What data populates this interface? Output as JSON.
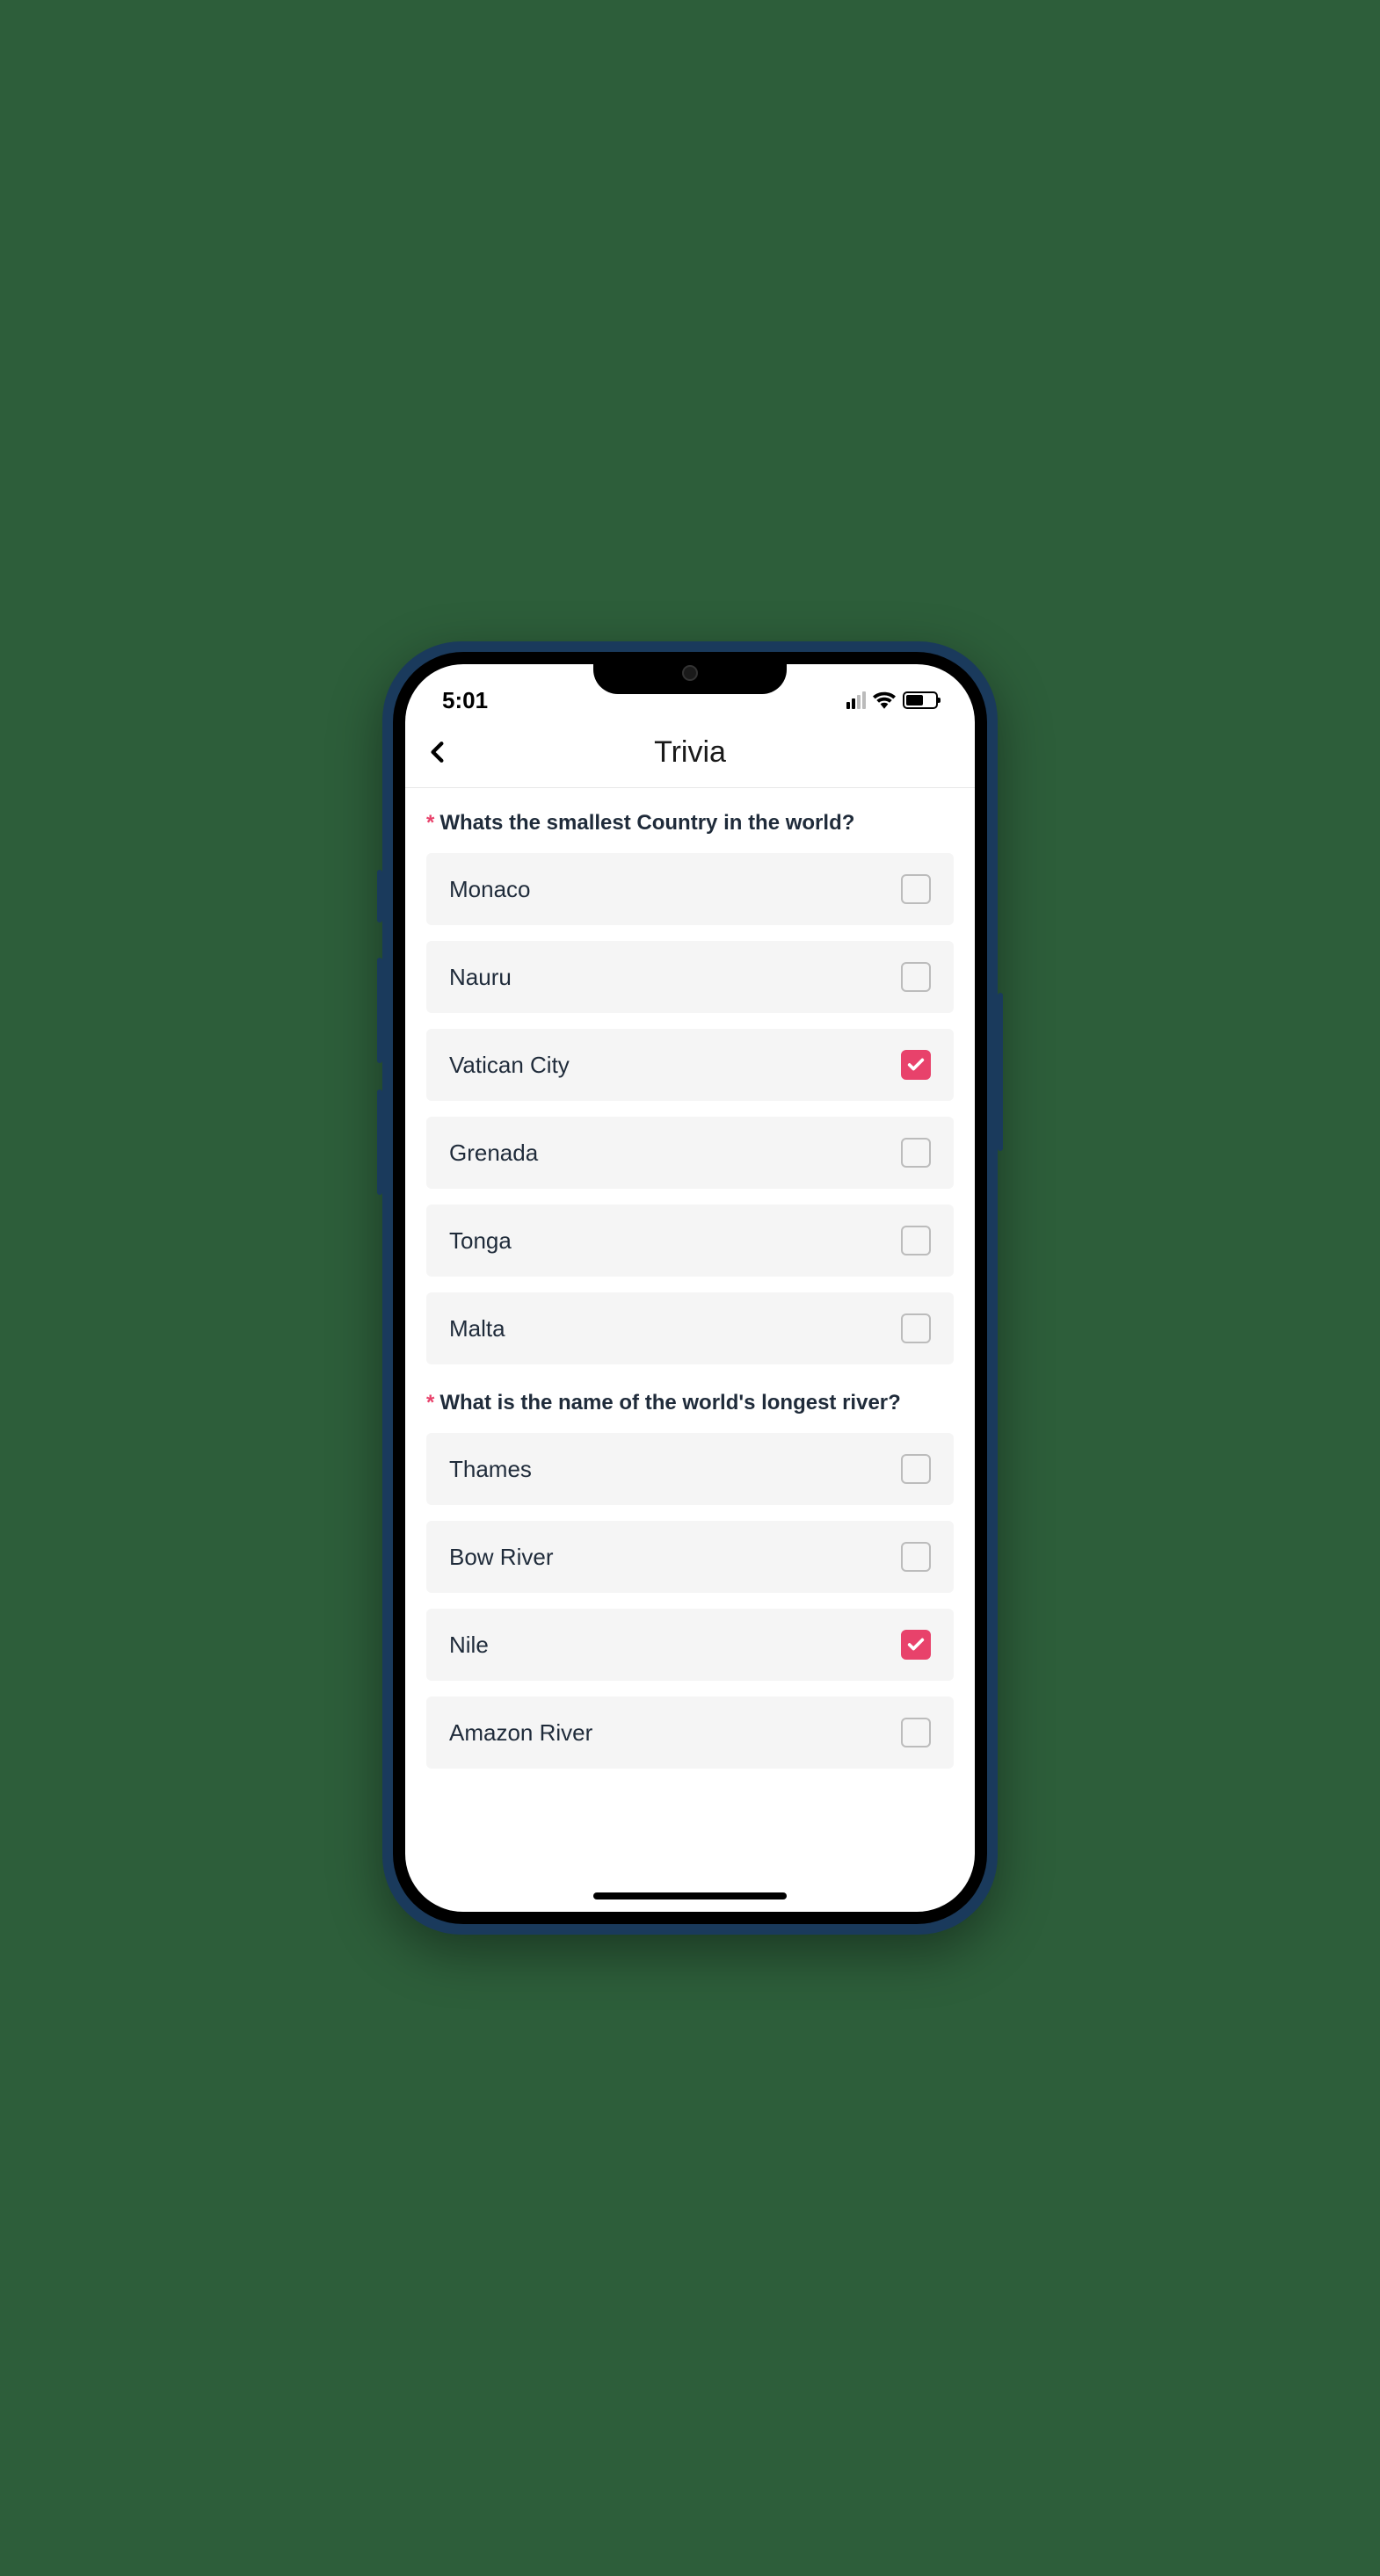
{
  "statusBar": {
    "time": "5:01"
  },
  "header": {
    "title": "Trivia"
  },
  "questions": [
    {
      "required": true,
      "text": "Whats the smallest Country in the world?",
      "options": [
        {
          "label": "Monaco",
          "checked": false
        },
        {
          "label": "Nauru",
          "checked": false
        },
        {
          "label": "Vatican City",
          "checked": true
        },
        {
          "label": "Grenada",
          "checked": false
        },
        {
          "label": "Tonga",
          "checked": false
        },
        {
          "label": "Malta",
          "checked": false
        }
      ]
    },
    {
      "required": true,
      "text": "What is the name of the world's longest river?",
      "options": [
        {
          "label": "Thames",
          "checked": false
        },
        {
          "label": "Bow River",
          "checked": false
        },
        {
          "label": "Nile",
          "checked": true
        },
        {
          "label": "Amazon River",
          "checked": false
        }
      ]
    }
  ]
}
